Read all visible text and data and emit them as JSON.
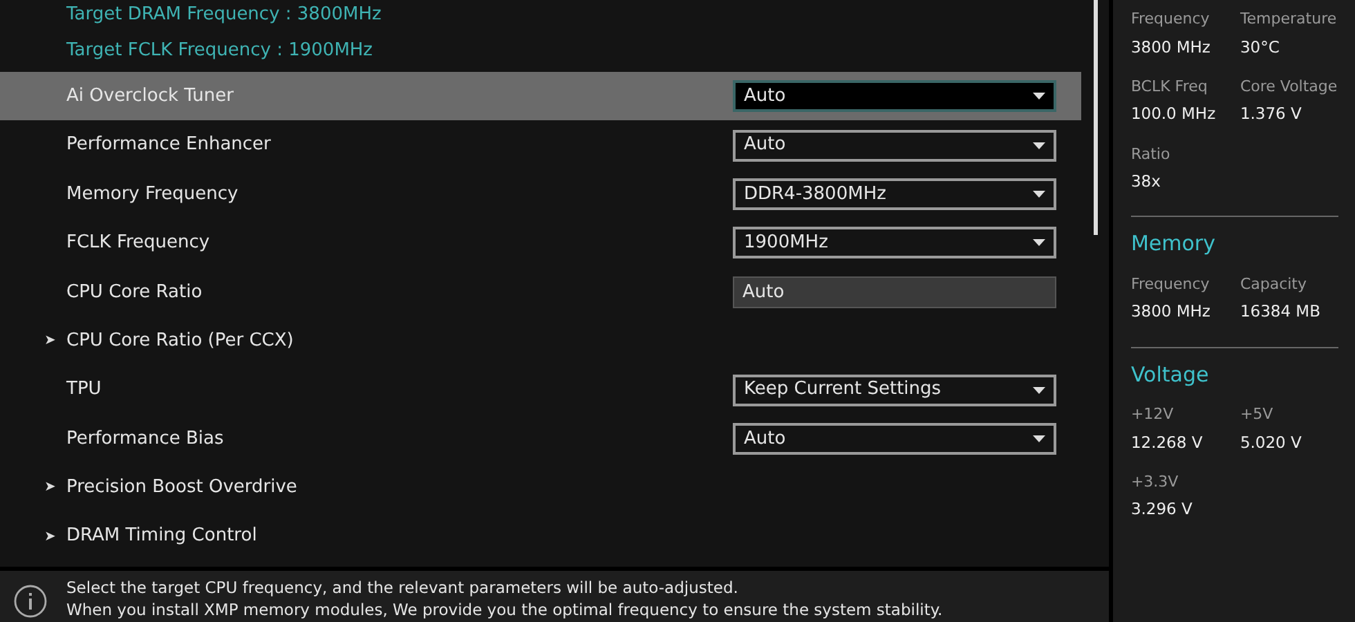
{
  "info_lines": [
    "Target DRAM Frequency : 3800MHz",
    "Target FCLK Frequency : 1900MHz"
  ],
  "settings": [
    {
      "label": "Ai Overclock Tuner",
      "kind": "dropdown",
      "value": "Auto",
      "selected": true
    },
    {
      "label": "Performance Enhancer",
      "kind": "dropdown",
      "value": "Auto",
      "selected": false
    },
    {
      "label": "Memory Frequency",
      "kind": "dropdown",
      "value": "DDR4-3800MHz",
      "selected": false
    },
    {
      "label": "FCLK Frequency",
      "kind": "dropdown",
      "value": "1900MHz",
      "selected": false
    },
    {
      "label": "CPU Core Ratio",
      "kind": "readonly",
      "value": "Auto",
      "selected": false
    },
    {
      "label": "CPU Core Ratio (Per CCX)",
      "kind": "submenu",
      "arrow": "➤",
      "selected": false
    },
    {
      "label": "TPU",
      "kind": "dropdown",
      "value": "Keep Current Settings",
      "selected": false
    },
    {
      "label": "Performance Bias",
      "kind": "dropdown",
      "value": "Auto",
      "selected": false
    },
    {
      "label": "Precision Boost Overdrive",
      "kind": "submenu",
      "arrow": "➤",
      "selected": false
    },
    {
      "label": "DRAM Timing Control",
      "kind": "submenu",
      "arrow": "➤",
      "selected": false
    }
  ],
  "help": {
    "lines": [
      "Select the target CPU frequency, and the relevant parameters will be auto-adjusted.",
      "When you install XMP memory modules, We provide you the optimal frequency to ensure the system stability."
    ]
  },
  "monitor": [
    {
      "items": [
        {
          "label": "Frequency",
          "value": "3800 MHz"
        },
        {
          "label": "Temperature",
          "value": "30°C"
        },
        {
          "label": "BCLK Freq",
          "value": "100.0 MHz"
        },
        {
          "label": "Core Voltage",
          "value": "1.376 V"
        },
        {
          "label": "Ratio",
          "value": "38x"
        }
      ]
    },
    {
      "title": "Memory",
      "items": [
        {
          "label": "Frequency",
          "value": "3800 MHz"
        },
        {
          "label": "Capacity",
          "value": "16384 MB"
        }
      ]
    },
    {
      "title": "Voltage",
      "items": [
        {
          "label": "+12V",
          "value": "12.268 V"
        },
        {
          "label": "+5V",
          "value": "5.020 V"
        },
        {
          "label": "+3.3V",
          "value": "3.296 V"
        }
      ]
    }
  ]
}
